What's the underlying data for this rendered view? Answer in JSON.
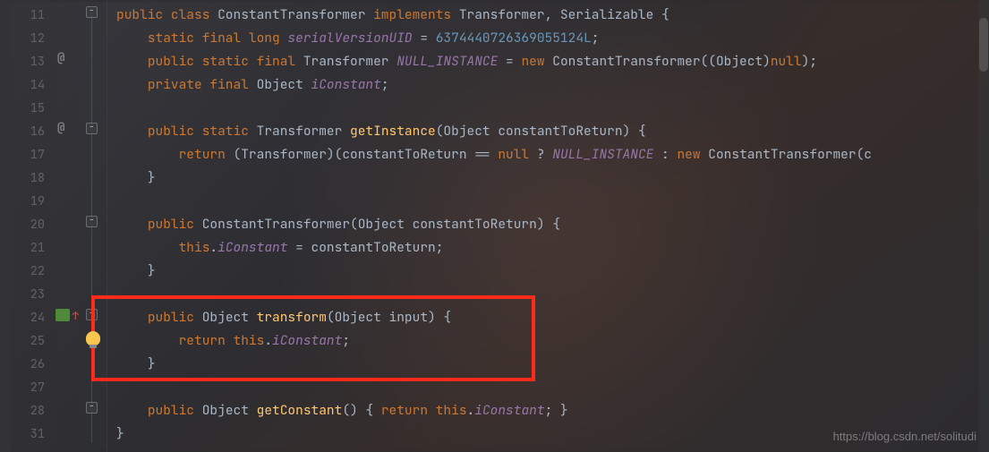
{
  "gutter": {
    "lines": [
      "11",
      "12",
      "13",
      "14",
      "15",
      "16",
      "17",
      "18",
      "19",
      "20",
      "21",
      "22",
      "23",
      "24",
      "25",
      "26",
      "27",
      "28",
      "31"
    ]
  },
  "markers": {
    "at1": "@",
    "at2": "@"
  },
  "code": {
    "l11_public": "public ",
    "l11_class": "class ",
    "l11_name": "ConstantTransformer ",
    "l11_implements": "implements ",
    "l11_ifaces": "Transformer, Serializable {",
    "l12_mods": "static final long ",
    "l12_field": "serialVersionUID",
    "l12_eq": " = ",
    "l12_val": "6374440726369055124L",
    "l12_semi": ";",
    "l13_mods": "public static final ",
    "l13_type": "Transformer ",
    "l13_field": "NULL_INSTANCE",
    "l13_eq": " = ",
    "l13_new": "new ",
    "l13_ctor": "ConstantTransformer((Object)",
    "l13_null": "null",
    "l13_end": ");",
    "l14_mods": "private final ",
    "l14_type": "Object ",
    "l14_field": "iConstant",
    "l14_semi": ";",
    "l16_mods": "public static ",
    "l16_type": "Transformer ",
    "l16_method": "getInstance",
    "l16_params": "(Object constantToReturn) {",
    "l17_return": "return ",
    "l17_cast": "(Transformer)(constantToReturn == ",
    "l17_null": "null",
    "l17_q": " ? ",
    "l17_const": "NULL_INSTANCE",
    "l17_colon": " : ",
    "l17_new": "new ",
    "l17_rest": "ConstantTransformer(c",
    "l18_brace": "}",
    "l20_mods": "public ",
    "l20_ctor": "ConstantTransformer",
    "l20_params": "(Object constantToReturn) {",
    "l21_this": "this",
    "l21_dot": ".",
    "l21_field": "iConstant",
    "l21_eq": " = constantToReturn;",
    "l22_brace": "}",
    "l24_mods": "public ",
    "l24_type": "Object ",
    "l24_method": "transform",
    "l24_params": "(Object input) {",
    "l25_return": "return ",
    "l25_this": "this",
    "l25_dot": ".",
    "l25_field": "iConstant",
    "l25_semi": ";",
    "l26_brace": "}",
    "l28_mods": "public ",
    "l28_type": "Object ",
    "l28_method": "getConstant",
    "l28_params": "() { ",
    "l28_return": "return ",
    "l28_this": "this",
    "l28_dot": ".",
    "l28_field": "iConstant",
    "l28_end": "; }",
    "l31_brace": "}"
  },
  "watermark": "https://blog.csdn.net/solitudi"
}
